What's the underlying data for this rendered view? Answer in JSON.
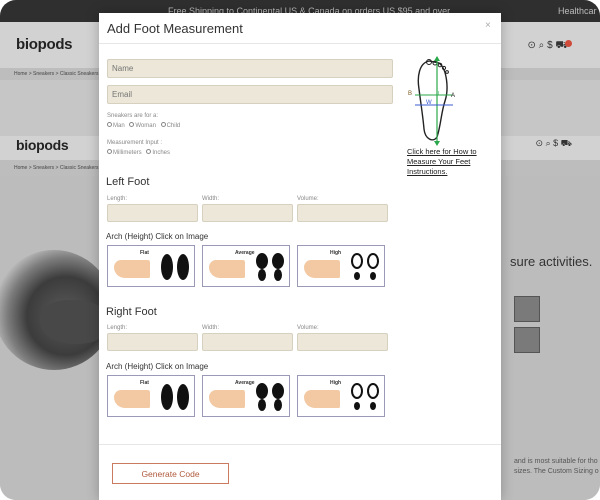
{
  "background": {
    "promo_text": "Free Shipping to Continental US & Canada on orders US $95 and over",
    "promo_right": "Healthcar",
    "logo": "biopods",
    "breadcrumb": "Home > Sneakers > Classic Sneakers",
    "product_text": "sure activities.",
    "desc_line1": "and is most suitable for tho",
    "desc_line2": "sizes. The Custom Sizing o",
    "cart_count": "0"
  },
  "modal": {
    "title": "Add Foot Measurement",
    "close_icon": "×",
    "name_placeholder": "Name",
    "email_placeholder": "Email",
    "sneakers_label": "Sneakers are for a:",
    "sneakers_options": [
      "Man",
      "Woman",
      "Child"
    ],
    "measurement_label": "Measurement Input :",
    "measurement_options": [
      "Millimeters",
      "Inches"
    ],
    "instructions_link": "Click here for How to Measure Your Feet Instructions.",
    "left_foot": {
      "title": "Left Foot",
      "length_label": "Length:",
      "width_label": "Width:",
      "volume_label": "Volume:",
      "arch_label": "Arch (Height) Click on Image",
      "arch_options": [
        "Flat",
        "Average",
        "High"
      ]
    },
    "right_foot": {
      "title": "Right Foot",
      "length_label": "Length:",
      "width_label": "Width:",
      "volume_label": "Volume:",
      "arch_label": "Arch (Height) Click on Image",
      "arch_options": [
        "Flat",
        "Average",
        "High"
      ]
    },
    "generate_button": "Generate Code"
  },
  "diagram_labels": {
    "b": "B",
    "w": "W",
    "l": "L",
    "a": "A"
  },
  "colors": {
    "input_bg": "#ece7d8",
    "button_border": "#c97a5f",
    "arch_border": "#9a9ab8",
    "diagram_green": "#2aa84a"
  }
}
